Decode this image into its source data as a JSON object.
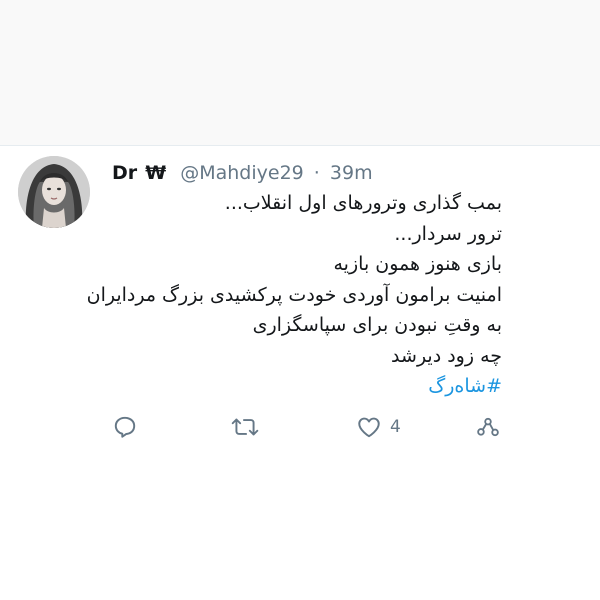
{
  "tweet": {
    "display_name": "Dr",
    "name_symbol": "₩",
    "handle": "@Mahdiye29",
    "separator": "·",
    "time": "39m",
    "lines": [
      "بمب گذاری وترورهای اول انقلاب...",
      "ترور سردار...",
      "بازی هنوز همون بازیه",
      "امنیت برامون آوردی خودت پرکشیدی بزرگ مردایران",
      "به وقتِ نبودن برای سپاسگزاری",
      "چه زود دیرشد"
    ],
    "hashtag": "#شاه‌رگ",
    "actions": {
      "reply_icon": "reply-icon",
      "retweet_icon": "retweet-icon",
      "like_icon": "heart-icon",
      "like_count": "4",
      "share_icon": "share-icon"
    }
  },
  "colors": {
    "background_top": "#f9f9f9",
    "text": "#14171a",
    "secondary": "#657786",
    "link": "#1b95e0",
    "divider": "#e6ecf0"
  }
}
